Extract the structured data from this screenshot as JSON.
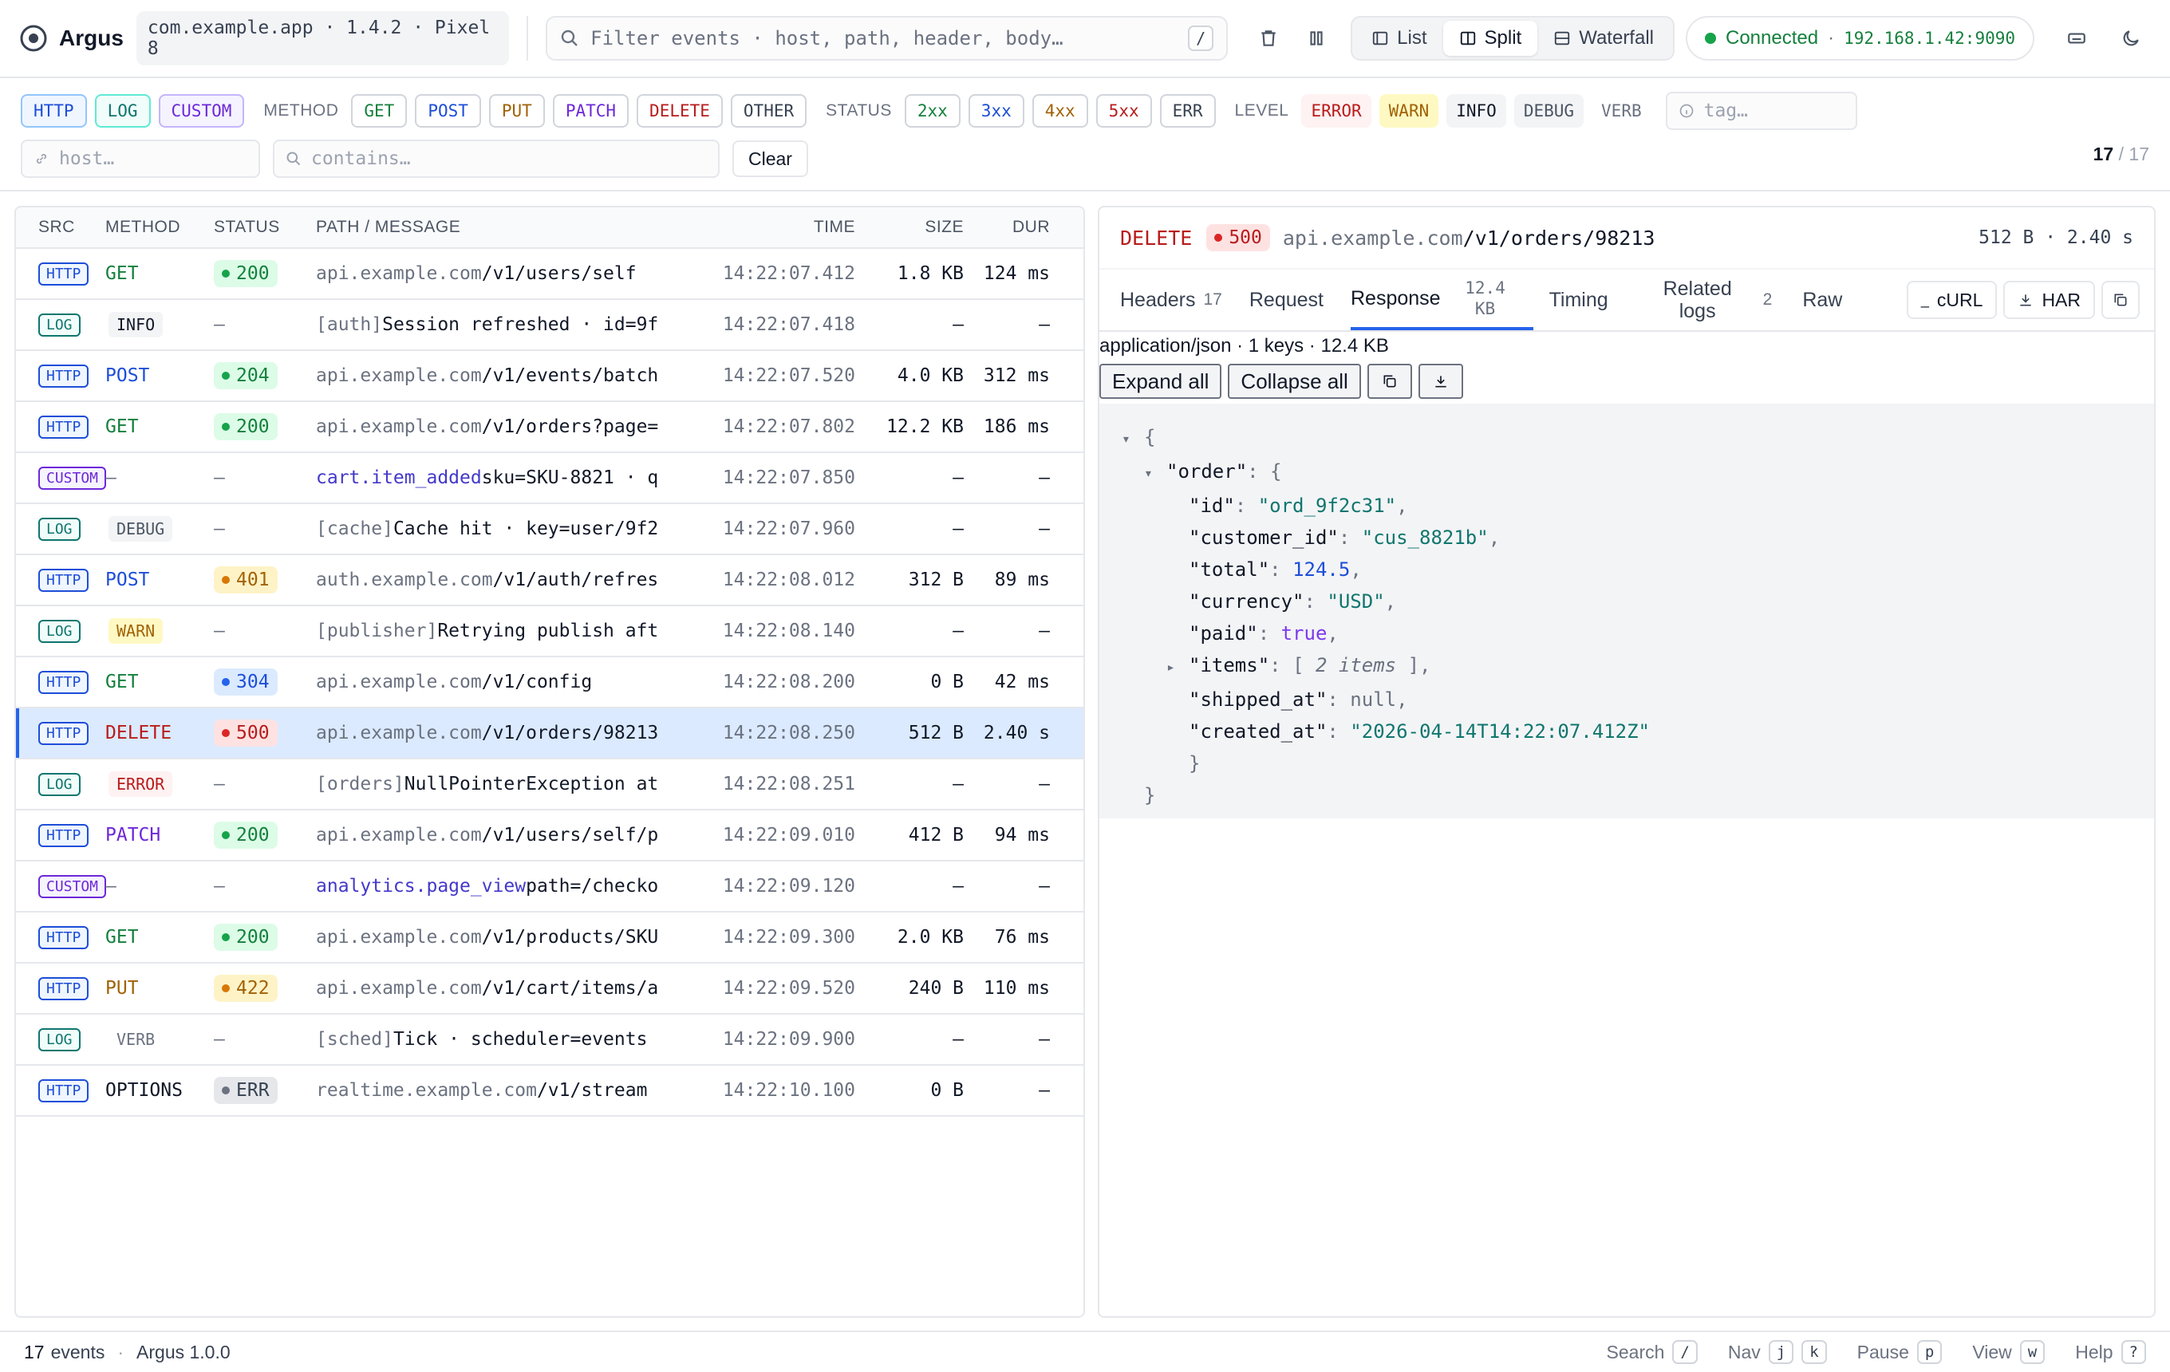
{
  "app": {
    "name": "Argus",
    "target": "com.example.app · 1.4.2 · Pixel 8"
  },
  "search": {
    "placeholder": "Filter events · host, path, header, body…",
    "shortcut": "/"
  },
  "views": [
    "List",
    "Split",
    "Waterfall"
  ],
  "active_view": "Split",
  "connection": {
    "status": "Connected",
    "address": "192.168.1.42:9090"
  },
  "filters": {
    "sources": [
      "HTTP",
      "LOG",
      "CUSTOM"
    ],
    "method_label": "METHOD",
    "methods": [
      "GET",
      "POST",
      "PUT",
      "PATCH",
      "DELETE",
      "OTHER"
    ],
    "status_label": "STATUS",
    "statuses": [
      "2xx",
      "3xx",
      "4xx",
      "5xx",
      "ERR"
    ],
    "level_label": "LEVEL",
    "levels": [
      "ERROR",
      "WARN",
      "INFO",
      "DEBUG",
      "VERB"
    ],
    "tag_placeholder": "tag…",
    "host_placeholder": "host…",
    "contains_placeholder": "contains…",
    "clear_label": "Clear",
    "shown": "17",
    "total": "17"
  },
  "list": {
    "columns": [
      "SRC",
      "METHOD",
      "STATUS",
      "PATH / MESSAGE",
      "TIME",
      "SIZE",
      "DUR"
    ],
    "rows": [
      {
        "src": "HTTP",
        "method": "GET",
        "status": "200",
        "host": "api.example.com",
        "path": "/v1/users/self",
        "time": "14:22:07.412",
        "size": "1.8 KB",
        "dur": "124 ms"
      },
      {
        "src": "LOG",
        "level": "INFO",
        "status": "—",
        "tag": "[auth]",
        "msg": "Session refreshed · id=9f",
        "time": "14:22:07.418",
        "size": "—",
        "dur": "—"
      },
      {
        "src": "HTTP",
        "method": "POST",
        "status": "204",
        "host": "api.example.com",
        "path": "/v1/events/batch",
        "time": "14:22:07.520",
        "size": "4.0 KB",
        "dur": "312 ms"
      },
      {
        "src": "HTTP",
        "method": "GET",
        "status": "200",
        "host": "api.example.com",
        "path": "/v1/orders?page=",
        "time": "14:22:07.802",
        "size": "12.2 KB",
        "dur": "186 ms"
      },
      {
        "src": "CUSTOM",
        "method": "—",
        "status": "—",
        "event": "cart.item_added",
        "msg": "sku=SKU-8821 · q",
        "time": "14:22:07.850",
        "size": "—",
        "dur": "—"
      },
      {
        "src": "LOG",
        "level": "DEBUG",
        "status": "—",
        "tag": "[cache]",
        "msg": "Cache hit · key=user/9f2",
        "time": "14:22:07.960",
        "size": "—",
        "dur": "—"
      },
      {
        "src": "HTTP",
        "method": "POST",
        "status": "401",
        "host": "auth.example.com",
        "path": "/v1/auth/refres",
        "time": "14:22:08.012",
        "size": "312 B",
        "dur": "89 ms"
      },
      {
        "src": "LOG",
        "level": "WARN",
        "status": "—",
        "tag": "[publisher]",
        "msg": "Retrying publish aft",
        "time": "14:22:08.140",
        "size": "—",
        "dur": "—"
      },
      {
        "src": "HTTP",
        "method": "GET",
        "status": "304",
        "host": "api.example.com",
        "path": "/v1/config",
        "time": "14:22:08.200",
        "size": "0 B",
        "dur": "42 ms"
      },
      {
        "src": "HTTP",
        "method": "DELETE",
        "status": "500",
        "host": "api.example.com",
        "path": "/v1/orders/98213",
        "time": "14:22:08.250",
        "size": "512 B",
        "dur": "2.40 s",
        "selected": true
      },
      {
        "src": "LOG",
        "level": "ERROR",
        "status": "—",
        "tag": "[orders]",
        "msg": "NullPointerException at",
        "time": "14:22:08.251",
        "size": "—",
        "dur": "—"
      },
      {
        "src": "HTTP",
        "method": "PATCH",
        "status": "200",
        "host": "api.example.com",
        "path": "/v1/users/self/p",
        "time": "14:22:09.010",
        "size": "412 B",
        "dur": "94 ms"
      },
      {
        "src": "CUSTOM",
        "method": "—",
        "status": "—",
        "event": "analytics.page_view",
        "msg": "path=/checko",
        "time": "14:22:09.120",
        "size": "—",
        "dur": "—"
      },
      {
        "src": "HTTP",
        "method": "GET",
        "status": "200",
        "host": "api.example.com",
        "path": "/v1/products/SKU",
        "time": "14:22:09.300",
        "size": "2.0 KB",
        "dur": "76 ms"
      },
      {
        "src": "HTTP",
        "method": "PUT",
        "status": "422",
        "host": "api.example.com",
        "path": "/v1/cart/items/a",
        "time": "14:22:09.520",
        "size": "240 B",
        "dur": "110 ms"
      },
      {
        "src": "LOG",
        "level": "VERB",
        "status": "—",
        "tag": "[sched]",
        "msg": "Tick · scheduler=events",
        "time": "14:22:09.900",
        "size": "—",
        "dur": "—"
      },
      {
        "src": "HTTP",
        "method": "OPTIONS",
        "status": "ERR",
        "host": "realtime.example.com",
        "path": "/v1/stream",
        "time": "14:22:10.100",
        "size": "0 B",
        "dur": "—"
      }
    ]
  },
  "detail": {
    "method": "DELETE",
    "status": "500",
    "host": "api.example.com",
    "path": "/v1/orders/98213",
    "summary": "512 B · 2.40 s",
    "tabs": [
      {
        "label": "Headers",
        "count": "17"
      },
      {
        "label": "Request",
        "count": ""
      },
      {
        "label": "Response",
        "count": "12.4 KB"
      },
      {
        "label": "Timing",
        "count": ""
      },
      {
        "label": "Related logs",
        "count": "2"
      },
      {
        "label": "Raw",
        "count": ""
      }
    ],
    "active_tab": "Response",
    "actions": [
      "cURL",
      "HAR"
    ],
    "content_meta": "application/json · 1 keys · 12.4 KB",
    "expand_label": "Expand all",
    "collapse_label": "Collapse all",
    "json": {
      "order_key": "\"order\"",
      "fields": [
        {
          "key": "\"id\"",
          "value": "\"ord_9f2c31\"",
          "kind": "string"
        },
        {
          "key": "\"customer_id\"",
          "value": "\"cus_8821b\"",
          "kind": "string"
        },
        {
          "key": "\"total\"",
          "value": "124.5",
          "kind": "number"
        },
        {
          "key": "\"currency\"",
          "value": "\"USD\"",
          "kind": "string"
        },
        {
          "key": "\"paid\"",
          "value": "true",
          "kind": "bool"
        },
        {
          "key": "\"items\"",
          "value": "2 items",
          "kind": "collapsed"
        },
        {
          "key": "\"shipped_at\"",
          "value": "null",
          "kind": "null"
        },
        {
          "key": "\"created_at\"",
          "value": "\"2026-04-14T14:22:07.412Z\"",
          "kind": "string"
        }
      ]
    }
  },
  "footer": {
    "events_count": "17",
    "events_label": "events",
    "version": "Argus 1.0.0",
    "shortcuts": [
      {
        "label": "Search",
        "keys": [
          "/"
        ]
      },
      {
        "label": "Nav",
        "keys": [
          "j",
          "k"
        ]
      },
      {
        "label": "Pause",
        "keys": [
          "p"
        ]
      },
      {
        "label": "View",
        "keys": [
          "w"
        ]
      },
      {
        "label": "Help",
        "keys": [
          "?"
        ]
      }
    ]
  },
  "colors": {
    "accent": "#2563eb",
    "connected": "#16a34a",
    "error": "#b91c1c",
    "selected_row": "#dbeafe"
  }
}
